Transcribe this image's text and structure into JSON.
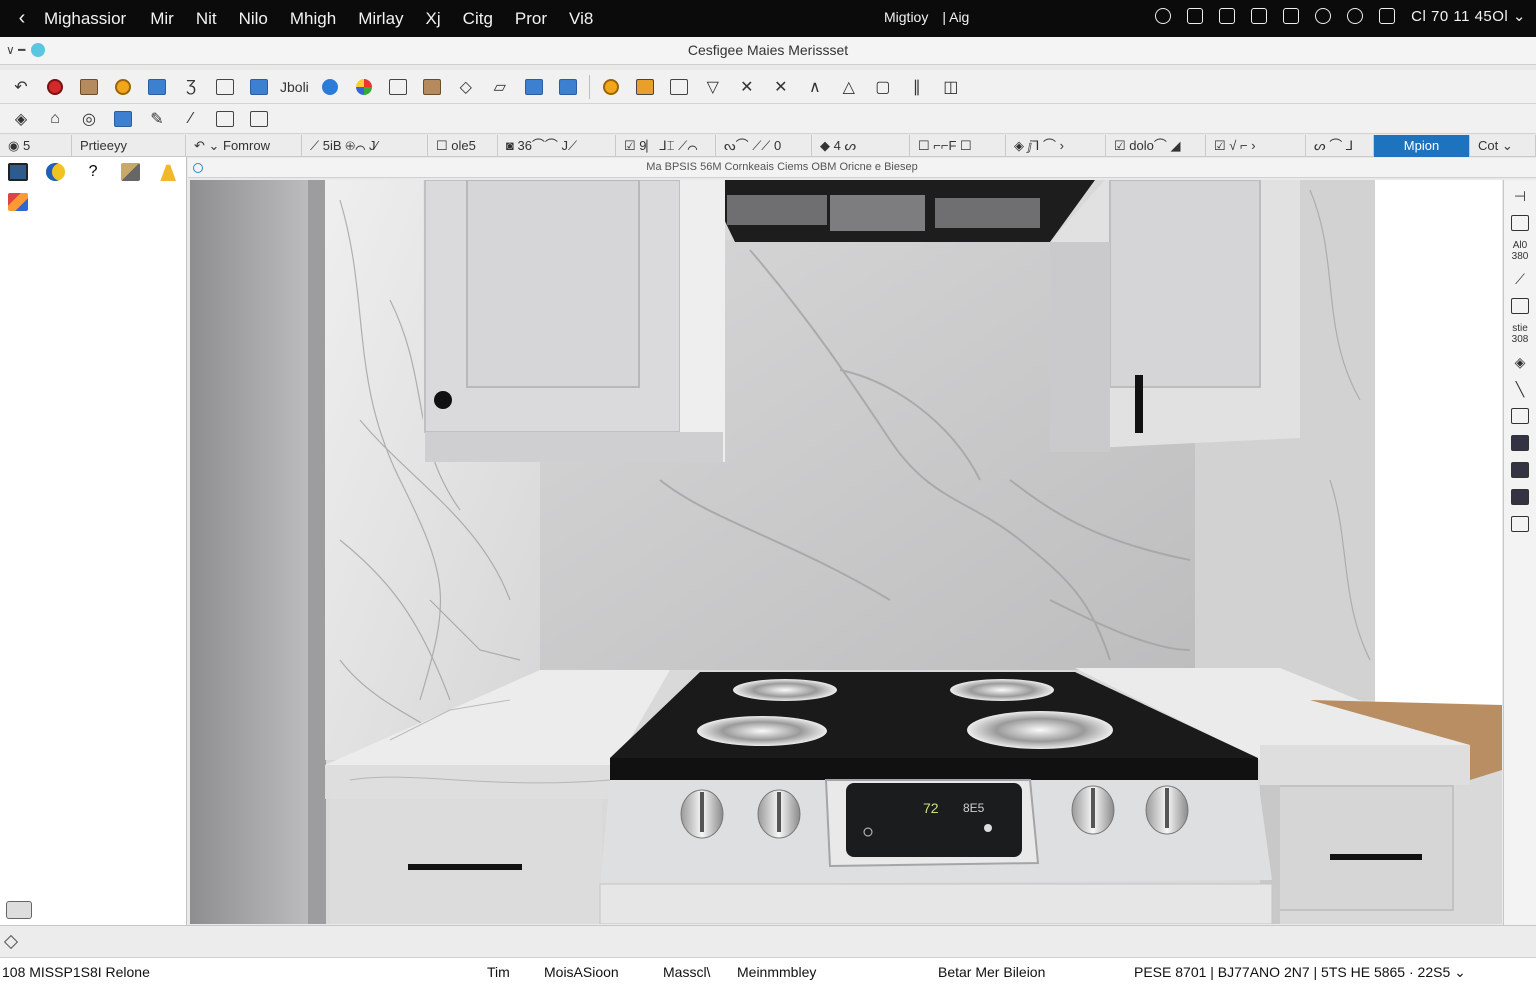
{
  "menubar": {
    "back": "‹",
    "items": [
      "Mighassior",
      "Mir",
      "Nit",
      "Nilo",
      "Mhigh",
      "Mirlay",
      "Xj",
      "Citg",
      "Pror",
      "Vi8"
    ],
    "center": [
      "Migtioy",
      "| Aig"
    ],
    "clock": "Cl 70 11 45Ol ⌄"
  },
  "window": {
    "title": "Cesfigee Maies Merissset",
    "controls": "∨ ━"
  },
  "toolbar2": {
    "label": "Jboli"
  },
  "tabs": [
    {
      "label": "◉ 5",
      "icon": "eye-icon"
    },
    {
      "label": "Prtieeyy"
    },
    {
      "label": "↶ ⌄  Fomrow"
    },
    {
      "label": "⟋ 5iB ⊕⌒ J⁄"
    },
    {
      "label": "☐ ole5"
    },
    {
      "label": "◙ 36⌒⌒ J⟋"
    },
    {
      "label": "☑ 9⎸⅃⌶ ⟋⌒"
    },
    {
      "label": "ᔓ⌒ ⟋⟋ 0"
    },
    {
      "label": "◆ 4 ᔕ"
    },
    {
      "label": "☐ ⌐⌐F ☐"
    },
    {
      "label": "◈ ⅉ⅂ ⌒ ›"
    },
    {
      "label": "☑ dolo⌒ ◢"
    },
    {
      "label": "☑ √ ⌐ ›"
    },
    {
      "label": "ᔕ ⌒ ⅃"
    },
    {
      "label": "Mpion"
    },
    {
      "label": "Cot ⌄"
    }
  ],
  "viewport": {
    "header": "Ma BPSIS 56M Cornkeais Ciems OBM Oricne e Biesep"
  },
  "rightstrip": {
    "label1": "Al0 380",
    "label2": "stie 308"
  },
  "statusbar": {
    "left": "108 MISSP1S8I Relone",
    "items": [
      "Tim",
      "MoisASioon",
      "Masscl\\",
      "Meinmmbley",
      "Betar Mer Bileion"
    ],
    "right": "PESE 8701 | BJ77ANO 2N7 | 5TS HE 5865 · 22S5 ⌄"
  },
  "colors": {
    "accent": "#1e73be",
    "menubar": "#0b0b0c",
    "cabinet": "#e4e4e5",
    "cooktop": "#1a1a1a",
    "wood": "#b98e62"
  }
}
